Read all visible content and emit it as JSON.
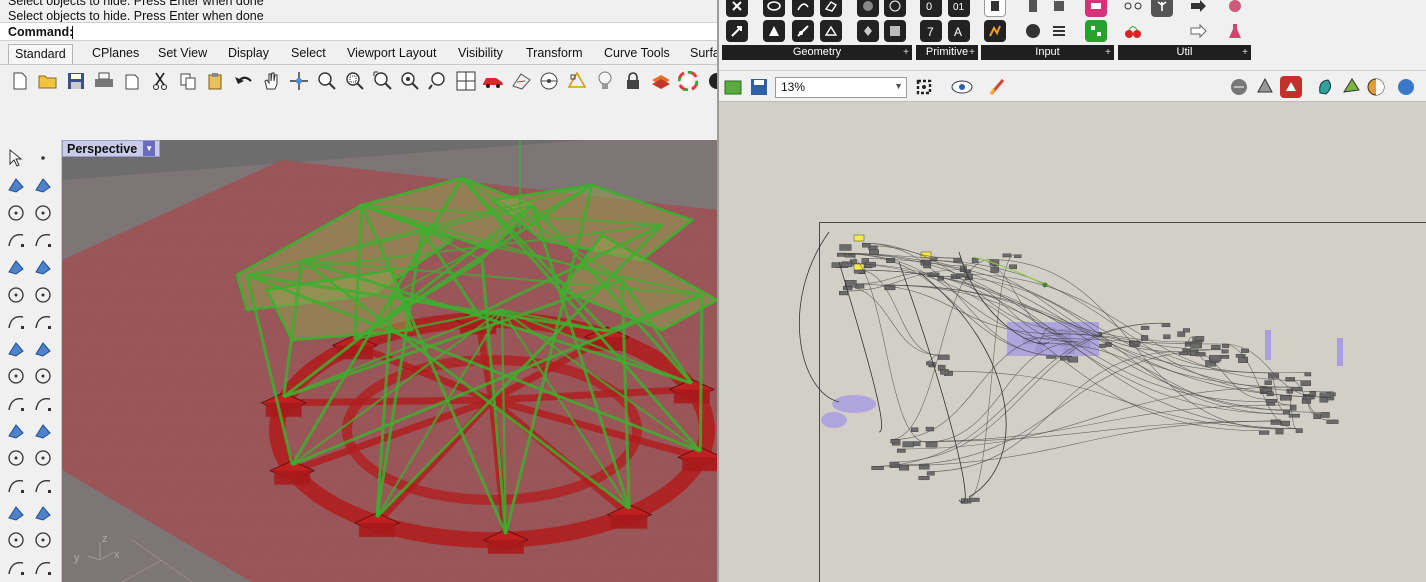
{
  "rhino": {
    "command_history": [
      "Select objects to hide. Press Enter when done",
      "Select objects to hide. Press Enter when done"
    ],
    "command_prompt": "Command:",
    "tabs": [
      "Standard",
      "CPlanes",
      "Set View",
      "Display",
      "Select",
      "Viewport Layout",
      "Visibility",
      "Transform",
      "Curve Tools",
      "Surfa"
    ],
    "active_tab": "Standard",
    "toolbar_icons": [
      "new-icon",
      "open-icon",
      "save-icon",
      "print-icon",
      "import-icon",
      "cut-icon",
      "copy-icon",
      "paste-icon",
      "undo-icon",
      "pan-icon",
      "rotate-icon",
      "zoom-icon",
      "zoom-window-icon",
      "zoom-extents-icon",
      "zoom-selected-icon",
      "zoom-dynamic-icon",
      "four-view-icon",
      "car-icon",
      "cplane-icon",
      "point-icon",
      "snap-icon",
      "light-icon",
      "lock-icon",
      "layer-icon",
      "color-wheel-icon",
      "render-icon"
    ],
    "side_tools": [
      "select-icon",
      "point-icon",
      "polyline-icon",
      "curve-icon",
      "circle-icon",
      "ellipse-icon",
      "arc-icon",
      "rectangle-icon",
      "polygon-icon",
      "freeform-icon",
      "surface-icon",
      "surface-edit-icon",
      "box-icon",
      "sphere-icon",
      "cylinder-icon",
      "plane-icon",
      "transform-icon",
      "gumball-icon",
      "split-icon",
      "trim-icon",
      "boolean-icon",
      "points-icon",
      "fillet-icon",
      "offset-icon",
      "text-icon",
      "dimension-icon",
      "array-icon",
      "align-icon",
      "block-icon",
      "analyze-icon",
      "grid-icon",
      "transform2-icon"
    ],
    "viewport_label": "Perspective",
    "axis_labels": {
      "x": "x",
      "y": "y",
      "z": "z"
    }
  },
  "gh": {
    "groups": [
      "Geometry",
      "Primitive",
      "Input",
      "Util"
    ],
    "zoom": "13%"
  },
  "colors": {
    "model_green": "#3fae2f",
    "model_red": "#b21c1c",
    "ground": "#9a5559",
    "gh_canvas": "#d2d0c6",
    "group_purple": "#a99ee0"
  }
}
